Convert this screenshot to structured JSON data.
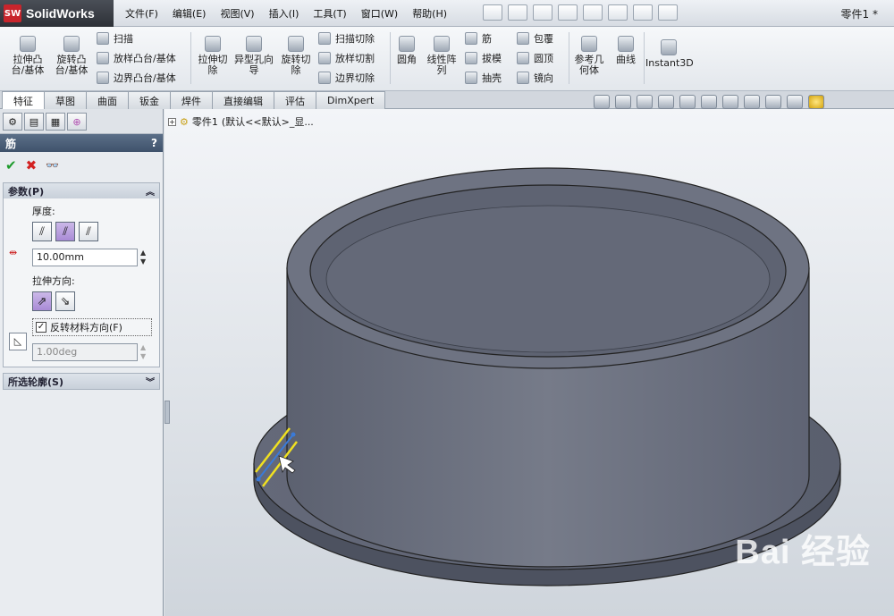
{
  "app": {
    "logo_mark": "SW",
    "name": "SolidWorks",
    "document_title": "零件1 *"
  },
  "menu": [
    "文件(F)",
    "编辑(E)",
    "视图(V)",
    "插入(I)",
    "工具(T)",
    "窗口(W)",
    "帮助(H)"
  ],
  "ribbon": {
    "extrude_boss": "拉伸凸台/基体",
    "revolve_boss": "旋转凸台/基体",
    "sweep": "扫描",
    "loft_boss": "放样凸台/基体",
    "boundary_boss": "边界凸台/基体",
    "extrude_cut": "拉伸切除",
    "hole_wizard": "异型孔向导",
    "revolve_cut": "旋转切除",
    "sweep_cut": "扫描切除",
    "loft_cut": "放样切割",
    "boundary_cut": "边界切除",
    "fillet": "圆角",
    "linear_pattern": "线性阵列",
    "rib": "筋",
    "draft": "拔模",
    "shell": "抽壳",
    "wrap": "包覆",
    "dome": "圆顶",
    "mirror": "镜向",
    "ref_geometry": "参考几何体",
    "curves": "曲线",
    "instant3d": "Instant3D"
  },
  "tabs": [
    "特征",
    "草图",
    "曲面",
    "钣金",
    "焊件",
    "直接编辑",
    "评估",
    "DimXpert"
  ],
  "active_tab": "特征",
  "property_manager": {
    "title": "筋",
    "help": "?",
    "ok_glyph": "✔",
    "cancel_glyph": "✖",
    "preview_glyph": "👓",
    "params_header": "参数(P)",
    "thickness_label": "厚度:",
    "thickness_value": "10.00mm",
    "direction_label": "拉伸方向:",
    "flip_material_label": "反转材料方向(F)",
    "flip_material_checked": true,
    "draft_value": "1.00deg",
    "profiles_header": "所选轮廓(S)"
  },
  "tree": {
    "part_label": "零件1",
    "config_label": "(默认<<默认>_显..."
  },
  "watermark": "Bai 经验",
  "colors": {
    "model_body": "#6f7482",
    "rib_highlight": "#f0e020",
    "accent": "#3f526b"
  }
}
